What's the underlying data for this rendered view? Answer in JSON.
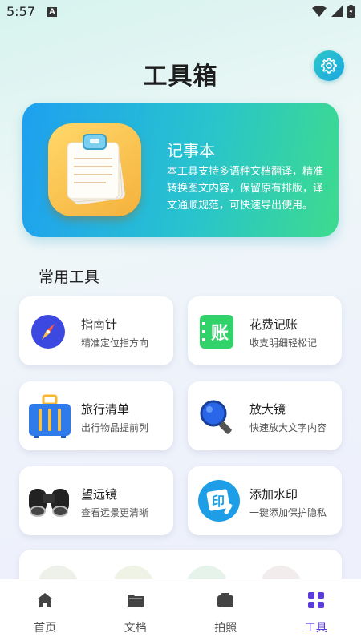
{
  "status_bar": {
    "time": "5:57",
    "a_badge": "A"
  },
  "header": {
    "title": "工具箱"
  },
  "hero": {
    "title": "记事本",
    "description": "本工具支持多语种文档翻译，精准转换图文内容，保留原有排版，译文通顺规范，可快速导出使用。"
  },
  "section": {
    "title": "常用工具"
  },
  "tools": [
    {
      "name": "指南针",
      "desc": "精准定位指方向",
      "icon": "compass-icon"
    },
    {
      "name": "花费记账",
      "desc": "收支明细轻松记",
      "icon": "ledger-icon",
      "icon_text": "账"
    },
    {
      "name": "旅行清单",
      "desc": "出行物品提前列",
      "icon": "suitcase-icon"
    },
    {
      "name": "放大镜",
      "desc": "快速放大文字内容",
      "icon": "magnifier-icon"
    },
    {
      "name": "望远镜",
      "desc": "查看远景更清晰",
      "icon": "binoculars-icon"
    },
    {
      "name": "添加水印",
      "desc": "一键添加保护隐私",
      "icon": "watermark-icon",
      "icon_text": "印"
    }
  ],
  "tabbar": {
    "items": [
      {
        "label": "首页",
        "icon": "home-icon",
        "active": false
      },
      {
        "label": "文档",
        "icon": "folder-icon",
        "active": false
      },
      {
        "label": "拍照",
        "icon": "camera-icon",
        "active": false
      },
      {
        "label": "工具",
        "icon": "grid-icon",
        "active": true
      }
    ]
  },
  "colors": {
    "accent": "#5b3bd9",
    "hero_start": "#1ea0f0",
    "hero_end": "#3ddb8e"
  }
}
